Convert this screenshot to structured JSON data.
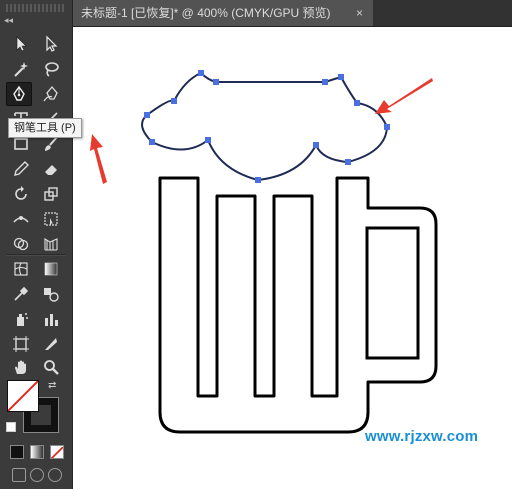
{
  "document_tab": {
    "title": "未标题-1 [已恢复]* @ 400% (CMYK/GPU 预览)",
    "close_glyph": "×"
  },
  "tooltip": {
    "text": "钢笔工具 (P)"
  },
  "watermark": {
    "text": "www.rjzxw.com"
  },
  "toolbar": {
    "active_tool": "pen-tool",
    "tools": [
      "selection-tool",
      "direct-selection-tool",
      "magic-wand-tool",
      "lasso-tool",
      "pen-tool",
      "curvature-tool",
      "type-tool",
      "line-tool",
      "rectangle-tool",
      "paintbrush-tool",
      "pencil-tool",
      "eraser-tool",
      "rotate-tool",
      "scale-tool",
      "width-tool",
      "free-transform-tool",
      "shape-builder-tool",
      "perspective-grid-tool",
      "mesh-tool",
      "gradient-tool",
      "eyedropper-tool",
      "blend-tool",
      "symbol-sprayer-tool",
      "column-graph-tool",
      "artboard-tool",
      "slice-tool",
      "hand-tool",
      "zoom-tool"
    ]
  },
  "colors": {
    "anchor": "#4a6fe0",
    "path": "#1f2a55",
    "accent_watermark": "#1a8fd6",
    "arrow": "#e63b2e"
  }
}
